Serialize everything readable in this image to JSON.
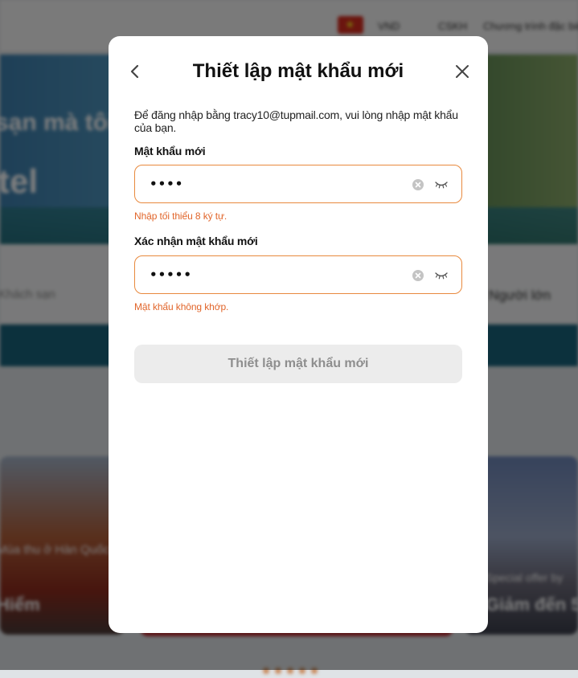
{
  "background": {
    "currency": "VND",
    "support": "CSKH",
    "program": "Chương trình đặc biệt",
    "hero_line1": "sạn mà tôi",
    "hero_line2": "tel",
    "search_placeholder": "Khách sạn",
    "guests": "Người lớn",
    "card_left_caption": "Mùa thu ở Hàn Quốc",
    "card_left_title": "Hiểm",
    "card_right_caption": "Special offer by",
    "card_right_title": "Giảm đến 5"
  },
  "modal": {
    "title": "Thiết lập mật khẩu mới",
    "description": "Để đăng nhập bằng tracy10@tupmail.com, vui lòng nhập mật khẩu của bạn.",
    "new_password": {
      "label": "Mật khẩu mới",
      "value": "••••",
      "error": "Nhập tối thiểu 8 ký tự."
    },
    "confirm_password": {
      "label": "Xác nhận mật khẩu mới",
      "value": "•••••",
      "error": "Mật khẩu không khớp."
    },
    "submit_label": "Thiết lập mật khẩu mới"
  },
  "colors": {
    "accent": "#e8893d",
    "error": "#e1652a",
    "disabled_button_bg": "#ececec",
    "disabled_button_text": "#8e8e8e"
  },
  "icons": [
    "back-arrow-icon",
    "close-icon",
    "clear-icon",
    "eye-closed-icon",
    "vietnam-flag-icon"
  ]
}
